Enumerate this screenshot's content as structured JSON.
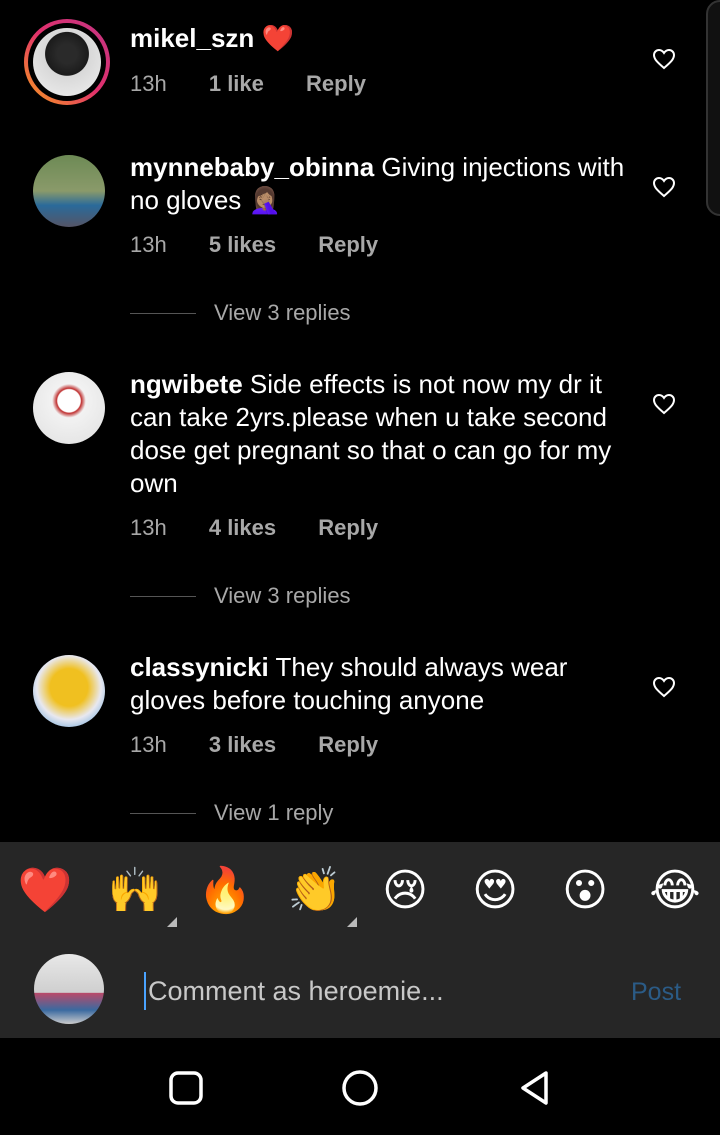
{
  "comments": [
    {
      "username": "mikel_szn",
      "emoji": "❤️",
      "text": "",
      "time": "13h",
      "likes": "1 like",
      "reply": "Reply"
    },
    {
      "username": "mynnebaby_obinna",
      "text": " Giving injections with no gloves 🤦🏽‍♀️",
      "time": "13h",
      "likes": "5 likes",
      "reply": "Reply",
      "view_replies": "View 3 replies"
    },
    {
      "username": "ngwibete",
      "text": " Side effects is not now my dr it can take 2yrs.please when u take second dose get pregnant so that o can go for my own",
      "time": "13h",
      "likes": "4 likes",
      "reply": "Reply",
      "view_replies": "View 3 replies"
    },
    {
      "username": "classynicki",
      "text": " They should always wear gloves before touching anyone",
      "time": "13h",
      "likes": "3 likes",
      "reply": "Reply",
      "view_replies": "View 1 reply"
    }
  ],
  "emoji_bar": [
    "❤️",
    "🙌",
    "🔥",
    "👏",
    "😢",
    "😍",
    "😮",
    "😂"
  ],
  "composer": {
    "placeholder": "Comment as heroemie...",
    "post_label": "Post"
  },
  "colors": {
    "accent_post": "#2b5b86",
    "muted": "#a8a8a8",
    "bar_bg": "#262626"
  },
  "nav": {
    "icons": [
      "recents-icon",
      "home-icon",
      "back-icon"
    ]
  }
}
